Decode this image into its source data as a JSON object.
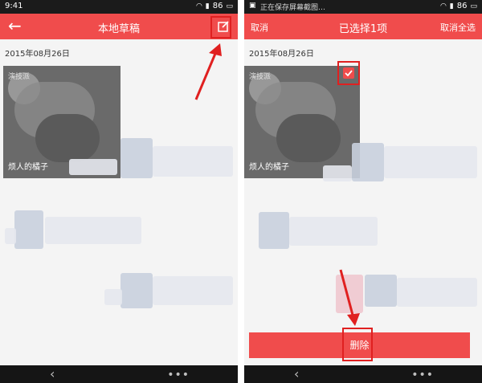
{
  "left": {
    "status": {
      "time": "9:41",
      "battery": "86"
    },
    "header": {
      "title": "本地草稿"
    },
    "date": "2015年08月26日",
    "thumb": {
      "watermark": "演技派",
      "caption": "烦人的橘子"
    }
  },
  "right": {
    "status": {
      "notice": "正在保存屏幕截图…",
      "battery": "86"
    },
    "header": {
      "title": "已选择1项",
      "cancel": "取消",
      "cancel_all": "取消全选"
    },
    "date": "2015年08月26日",
    "thumb": {
      "watermark": "演技派",
      "caption": "烦人的橘子"
    },
    "delete_label": "删除"
  },
  "colors": {
    "accent": "#f04c4c",
    "annotation": "#e02020"
  },
  "icons": [
    "back-arrow-icon",
    "edit-icon",
    "wifi-icon",
    "signal-icon",
    "battery-icon",
    "check-icon",
    "nav-back-icon",
    "nav-menu-icon",
    "annotation-arrow-icon"
  ]
}
